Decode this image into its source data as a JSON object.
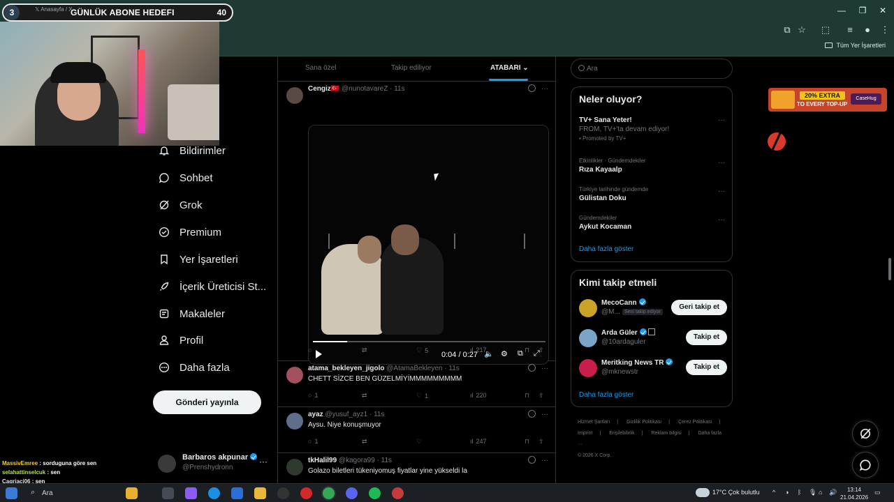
{
  "browser": {
    "tab_title": "Anasayfa / X",
    "bookmark_folder": "Tüm Yer İşaretleri"
  },
  "overlay": {
    "goal_number": "3",
    "goal_label": "GÜNLÜK ABONE HEDEFI",
    "goal_count": "40"
  },
  "sidebar": {
    "items": [
      {
        "label": "Bildirimler",
        "icon": "bell-icon"
      },
      {
        "label": "Sohbet",
        "icon": "chat-icon"
      },
      {
        "label": "Grok",
        "icon": "grok-icon"
      },
      {
        "label": "Premium",
        "icon": "premium-icon"
      },
      {
        "label": "Yer İşaretleri",
        "icon": "bookmark-icon"
      },
      {
        "label": "İçerik Üreticisi St...",
        "icon": "rocket-icon"
      },
      {
        "label": "Makaleler",
        "icon": "article-icon"
      },
      {
        "label": "Profil",
        "icon": "person-icon"
      },
      {
        "label": "Daha fazla",
        "icon": "more-circle-icon"
      }
    ],
    "post_button": "Gönderi yayınla",
    "profile": {
      "name": "Barbaros akpunar",
      "handle": "@Prenshydronn",
      "more": "···"
    }
  },
  "timeline": {
    "tabs": [
      "Sana özel",
      "Takip ediliyor",
      "ATABARI"
    ],
    "active_tab": "ATABARI",
    "tweets": [
      {
        "name": "Cengiz",
        "flag": "🇹🇷",
        "handle": "@nunotavareZ",
        "time": "· 11s",
        "text": "",
        "video": {
          "time": "0:04 / 0:27",
          "progress": 0.148
        },
        "stats": {
          "replies": "",
          "reposts": "",
          "likes": "5",
          "views": "217"
        }
      },
      {
        "name": "atama_bekleyen_jigolo",
        "handle": "@AtamaBekleyen",
        "time": "· 11s",
        "text": "CHETT SİZCE BEN GÜZELMİYİMMMMMMMMM",
        "stats": {
          "replies": "1",
          "reposts": "",
          "likes": "1",
          "views": "220"
        }
      },
      {
        "name": "ayaz",
        "handle": "@yusuf_ayz1",
        "time": "· 11s",
        "text": "Aysu. Niye konuşmuyor",
        "stats": {
          "replies": "1",
          "reposts": "",
          "likes": "",
          "views": "247"
        }
      },
      {
        "name": "tkHalil99",
        "handle": "@kagora99",
        "time": "· 11s",
        "text": "Golazo biletleri tükeniyomuş fiyatlar yine yükseldi la",
        "stats": {
          "replies": "",
          "reposts": "",
          "likes": "",
          "views": ""
        }
      }
    ]
  },
  "right": {
    "search_placeholder": "Ara",
    "trends_title": "Neler oluyor?",
    "trends": [
      {
        "context": "",
        "title": "TV+ Sana Yeter!",
        "subtitle": "FROM, TV+'ta devam ediyor!",
        "promo": "Promoted by TV+"
      },
      {
        "context": "Etkinlikler · Gündemdekiler",
        "title": "Rıza Kayaalp",
        "subtitle": "",
        "promo": ""
      },
      {
        "context": "Türkiye tarihinde gündemde",
        "title": "Gülistan Doku",
        "subtitle": "",
        "promo": ""
      },
      {
        "context": "Gündemdekiler",
        "title": "Aykut Kocaman",
        "subtitle": "",
        "promo": ""
      }
    ],
    "trends_more": "Daha fazla göster",
    "who_title": "Kimi takip etmeli",
    "who": [
      {
        "name": "MecoCann",
        "handle": "@M...",
        "follows_you": "Seni takip ediyor",
        "button": "Geri takip et",
        "avatar_color": "#c9a227"
      },
      {
        "name": "Arda Güler",
        "handle": "@10ardaguler",
        "follows_you": "",
        "button": "Takip et",
        "avatar_color": "#7aa5c8"
      },
      {
        "name": "Meritking News TR",
        "handle": "@mknewstr",
        "follows_you": "",
        "button": "Takip et",
        "avatar_color": "#c81d4d"
      }
    ],
    "who_more": "Daha fazla göster",
    "footer": [
      "Hizmet Şartları",
      "|",
      "Gizlilik Politikası",
      "|",
      "Çerez Politikası",
      "|",
      "Imprint",
      "|",
      "Erişilebilirlik",
      "|",
      "Reklam bilgisi",
      "|",
      "Daha fazla ···",
      "© 2026 X Corp."
    ]
  },
  "ad": {
    "extra": "20% EXTRA",
    "sub": "TO EVERY TOP-UP",
    "brand": "CaseHug"
  },
  "chat": [
    {
      "user": "MassivEmree",
      "text": " : sorduguna göre sen"
    },
    {
      "user": "selahattinselcuk",
      "text": " : sen"
    },
    {
      "user": "Cagriaci06",
      "text": " : sen"
    }
  ],
  "taskbar": {
    "search": "Ara",
    "weather": "17°C  Çok bulutlu",
    "time": "13:14",
    "date": "21.04.2026"
  }
}
